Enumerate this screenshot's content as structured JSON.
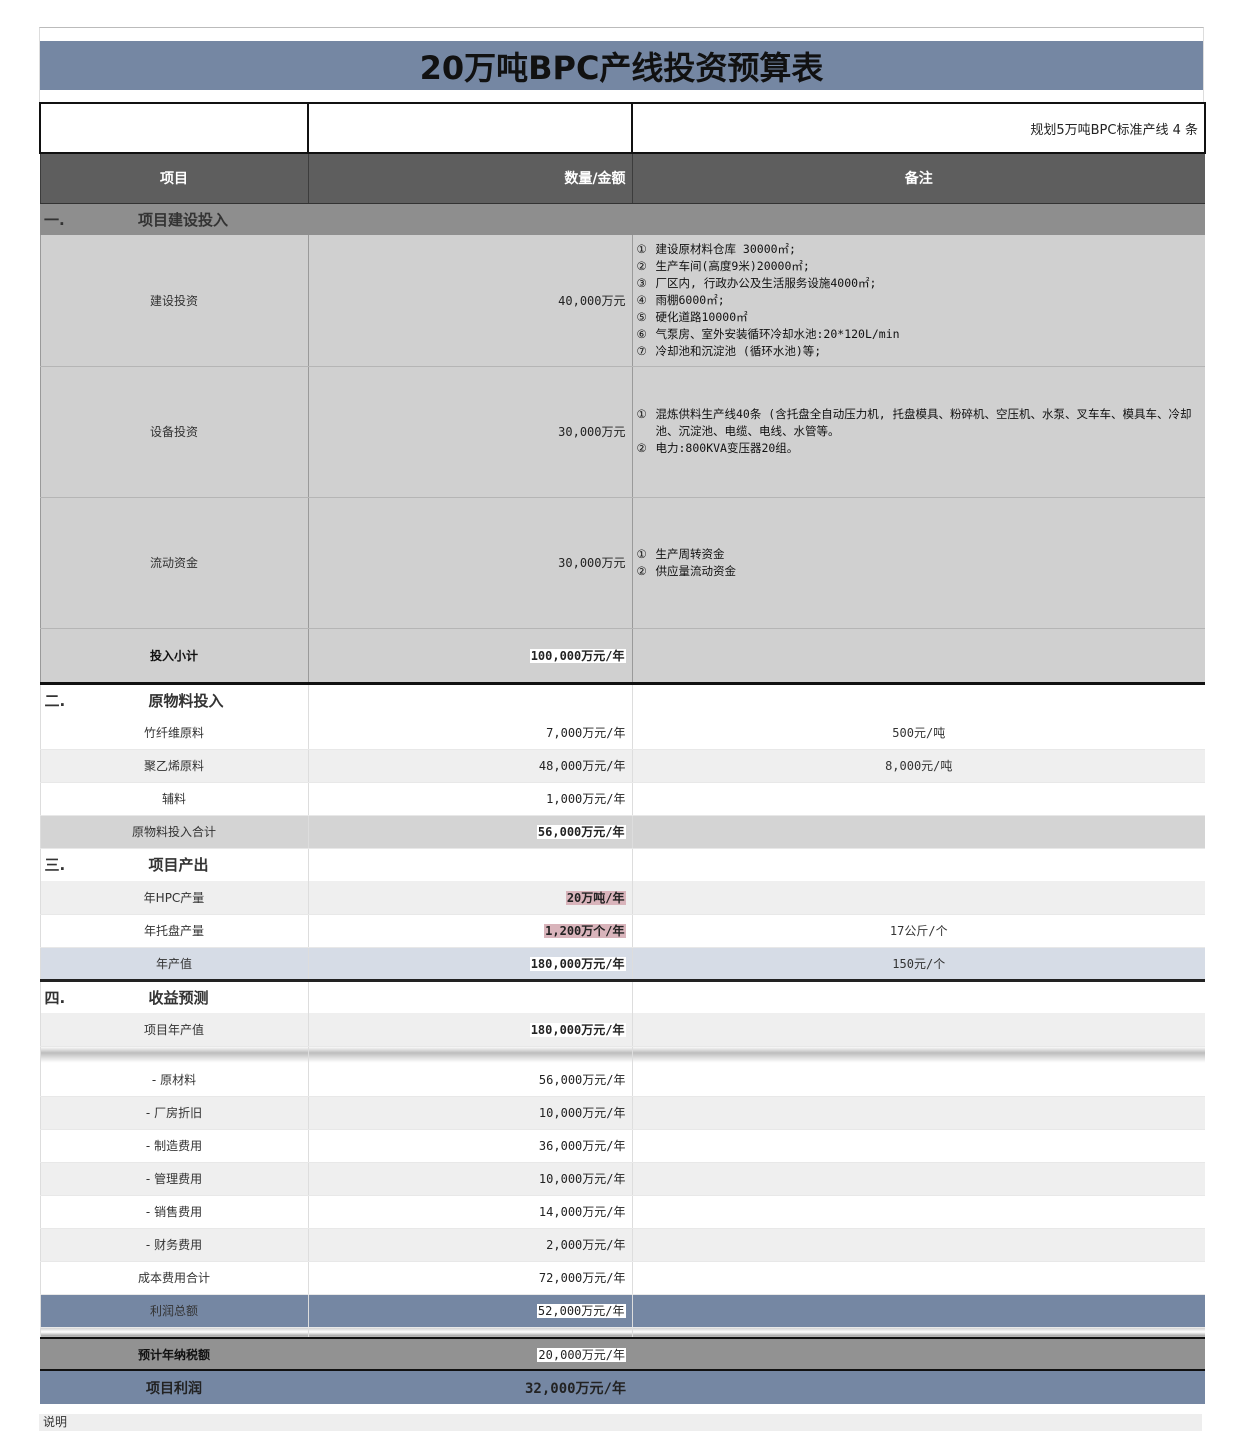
{
  "title": "20万吨BPC产线投资预算表",
  "plan_note": "规划5万吨BPC标准产线 4 条",
  "header": {
    "item": "项目",
    "amount": "数量/金额",
    "remark": "备注"
  },
  "section1": {
    "no": "一.",
    "title": "项目建设投入",
    "rows": [
      {
        "label": "建设投资",
        "amount": "40,000万元",
        "notes": [
          {
            "mark": "①",
            "text": "建设原材料仓库 30000㎡;"
          },
          {
            "mark": "②",
            "text": "生产车间(高度9米)20000㎡;"
          },
          {
            "mark": "③",
            "text": "厂区内, 行政办公及生活服务设施4000㎡;"
          },
          {
            "mark": "④",
            "text": "雨棚6000㎡;"
          },
          {
            "mark": "⑤",
            "text": "硬化道路10000㎡"
          },
          {
            "mark": "⑥",
            "text": "气泵房、室外安装循环冷却水池:20*120L/min"
          },
          {
            "mark": "⑦",
            "text": "冷却池和沉淀池 (循环水池)等;"
          }
        ]
      },
      {
        "label": "设备投资",
        "amount": "30,000万元",
        "notes": [
          {
            "mark": "①",
            "text": "混炼供料生产线40条 (含托盘全自动压力机, 托盘模具、粉碎机、空压机、水泵、叉车车、模具车、冷却池、沉淀池、电缆、电线、水管等。"
          },
          {
            "mark": "②",
            "text": "电力:800KVA变压器20组。"
          }
        ]
      },
      {
        "label": "流动资金",
        "amount": "30,000万元",
        "notes": [
          {
            "mark": "①",
            "text": "生产周转资金"
          },
          {
            "mark": "②",
            "text": "供应量流动资金"
          }
        ]
      }
    ],
    "subtotal": {
      "label": "投入小计",
      "amount": "100,000万元/年"
    }
  },
  "section2": {
    "no": "二.",
    "title": "原物料投入",
    "rows": [
      {
        "label": "竹纤维原料",
        "amount": "7,000万元/年",
        "note": "500元/吨"
      },
      {
        "label": "聚乙烯原料",
        "amount": "48,000万元/年",
        "note": "8,000元/吨"
      },
      {
        "label": "辅料",
        "amount": "1,000万元/年",
        "note": ""
      }
    ],
    "total": {
      "label": "原物料投入合计",
      "amount": "56,000万元/年"
    }
  },
  "section3": {
    "no": "三.",
    "title": "项目产出",
    "rows": [
      {
        "label": "年HPC产量",
        "amount": "20万吨/年",
        "note": ""
      },
      {
        "label": "年托盘产量",
        "amount": "1,200万个/年",
        "note": "17公斤/个"
      },
      {
        "label": "年产值",
        "amount": "180,000万元/年",
        "note": "150元/个"
      }
    ]
  },
  "section4": {
    "no": "四.",
    "title": "收益预测",
    "output": {
      "label": "项目年产值",
      "amount": "180,000万元/年"
    },
    "costs": [
      {
        "label": "- 原材料",
        "amount": "56,000万元/年"
      },
      {
        "label": "- 厂房折旧",
        "amount": "10,000万元/年"
      },
      {
        "label": "- 制造费用",
        "amount": "36,000万元/年"
      },
      {
        "label": "- 管理费用",
        "amount": "10,000万元/年"
      },
      {
        "label": "- 销售费用",
        "amount": "14,000万元/年"
      },
      {
        "label": "- 财务费用",
        "amount": "2,000万元/年"
      }
    ],
    "cost_total": {
      "label": "成本费用合计",
      "amount": "72,000万元/年"
    },
    "gross_profit": {
      "label": "利润总额",
      "amount": "52,000万元/年"
    },
    "tax": {
      "label": "预计年纳税额",
      "amount": "20,000万元/年"
    },
    "net_profit": {
      "label": "项目利润",
      "amount": "32,000万元/年"
    }
  },
  "footer_note": "说明"
}
